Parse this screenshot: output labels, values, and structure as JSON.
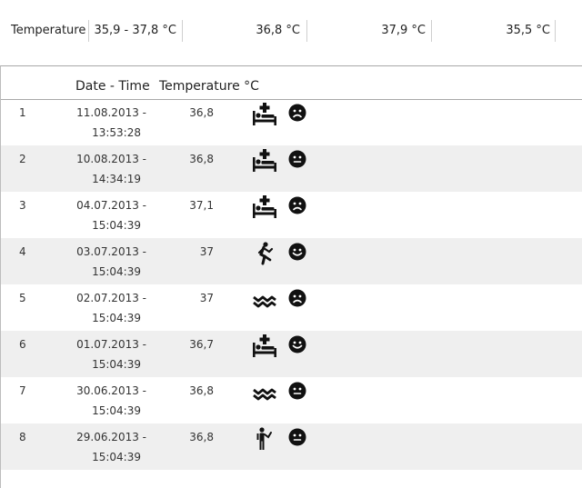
{
  "summary": {
    "label": "Temperature",
    "range": "35,9 - 37,8 °C",
    "avg": "36,8 °C",
    "max": "37,9 °C",
    "min": "35,5 °C"
  },
  "table": {
    "headers": {
      "index": "",
      "datetime": "Date - Time",
      "temperature": "Temperature °C"
    },
    "rows": [
      {
        "idx": "1",
        "date": "11.08.2013 -",
        "time": "13:53:28",
        "temp": "36,8",
        "activity": "bed-icon",
        "mood": "sad"
      },
      {
        "idx": "2",
        "date": "10.08.2013 -",
        "time": "14:34:19",
        "temp": "36,8",
        "activity": "bed-icon",
        "mood": "neutral"
      },
      {
        "idx": "3",
        "date": "04.07.2013 -",
        "time": "15:04:39",
        "temp": "37,1",
        "activity": "bed-icon",
        "mood": "sad"
      },
      {
        "idx": "4",
        "date": "03.07.2013 -",
        "time": "15:04:39",
        "temp": "37",
        "activity": "running-icon",
        "mood": "happy"
      },
      {
        "idx": "5",
        "date": "02.07.2013 -",
        "time": "15:04:39",
        "temp": "37",
        "activity": "swimming-icon",
        "mood": "sad"
      },
      {
        "idx": "6",
        "date": "01.07.2013 -",
        "time": "15:04:39",
        "temp": "36,7",
        "activity": "bed-icon",
        "mood": "happy"
      },
      {
        "idx": "7",
        "date": "30.06.2013 -",
        "time": "15:04:39",
        "temp": "36,8",
        "activity": "swimming-icon",
        "mood": "neutral"
      },
      {
        "idx": "8",
        "date": "29.06.2013 -",
        "time": "15:04:39",
        "temp": "36,8",
        "activity": "standing-person-icon",
        "mood": "neutral"
      }
    ]
  },
  "colors": {
    "row_alt": "#efefef",
    "divider": "#cfcfcf",
    "text": "#222222"
  }
}
